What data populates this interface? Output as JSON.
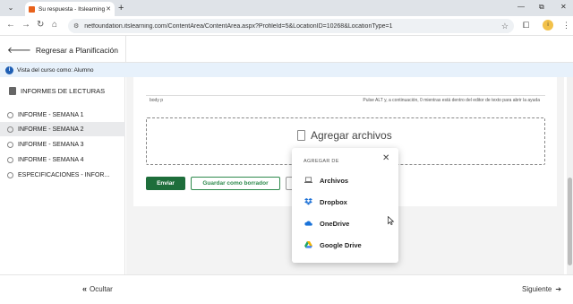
{
  "browser": {
    "tab_title": "Su respuesta - Itslearning",
    "url": "netfoundation.itslearning.com/ContentArea/ContentArea.aspx?ProfileId=5&LocationID=10268&LocationType=1",
    "avatar_initial": "i"
  },
  "header": {
    "back_label": "Regresar a Planificación"
  },
  "banner": {
    "text": "Vista del curso como: Alumno"
  },
  "sidebar": {
    "title": "INFORMES DE LECTURAS",
    "items": [
      {
        "label": "INFORME - SEMANA 1",
        "selected": false
      },
      {
        "label": "INFORME - SEMANA 2",
        "selected": true
      },
      {
        "label": "INFORME - SEMANA 3",
        "selected": false
      },
      {
        "label": "INFORME - SEMANA 4",
        "selected": false
      },
      {
        "label": "ESPECIFICACIONES - INFOR...",
        "selected": false
      }
    ]
  },
  "editor": {
    "path": "body  p",
    "hint": "Pulse ALT y, a continuación, 0 mientras está dentro del editor de texto para abrir la ayuda"
  },
  "dropzone": {
    "label": "Agregar archivos"
  },
  "buttons": {
    "send": "Enviar",
    "draft": "Guardar como borrador"
  },
  "popup": {
    "header": "AGREGAR DE",
    "options": [
      "Archivos",
      "Dropbox",
      "OneDrive",
      "Google Drive"
    ]
  },
  "footer": {
    "hide_label": "Ocultar",
    "next_label": "Siguiente"
  },
  "colors": {
    "primary_green": "#1e6e3b",
    "banner_bg": "#e7f1fb",
    "info_blue": "#1f5fb4"
  }
}
